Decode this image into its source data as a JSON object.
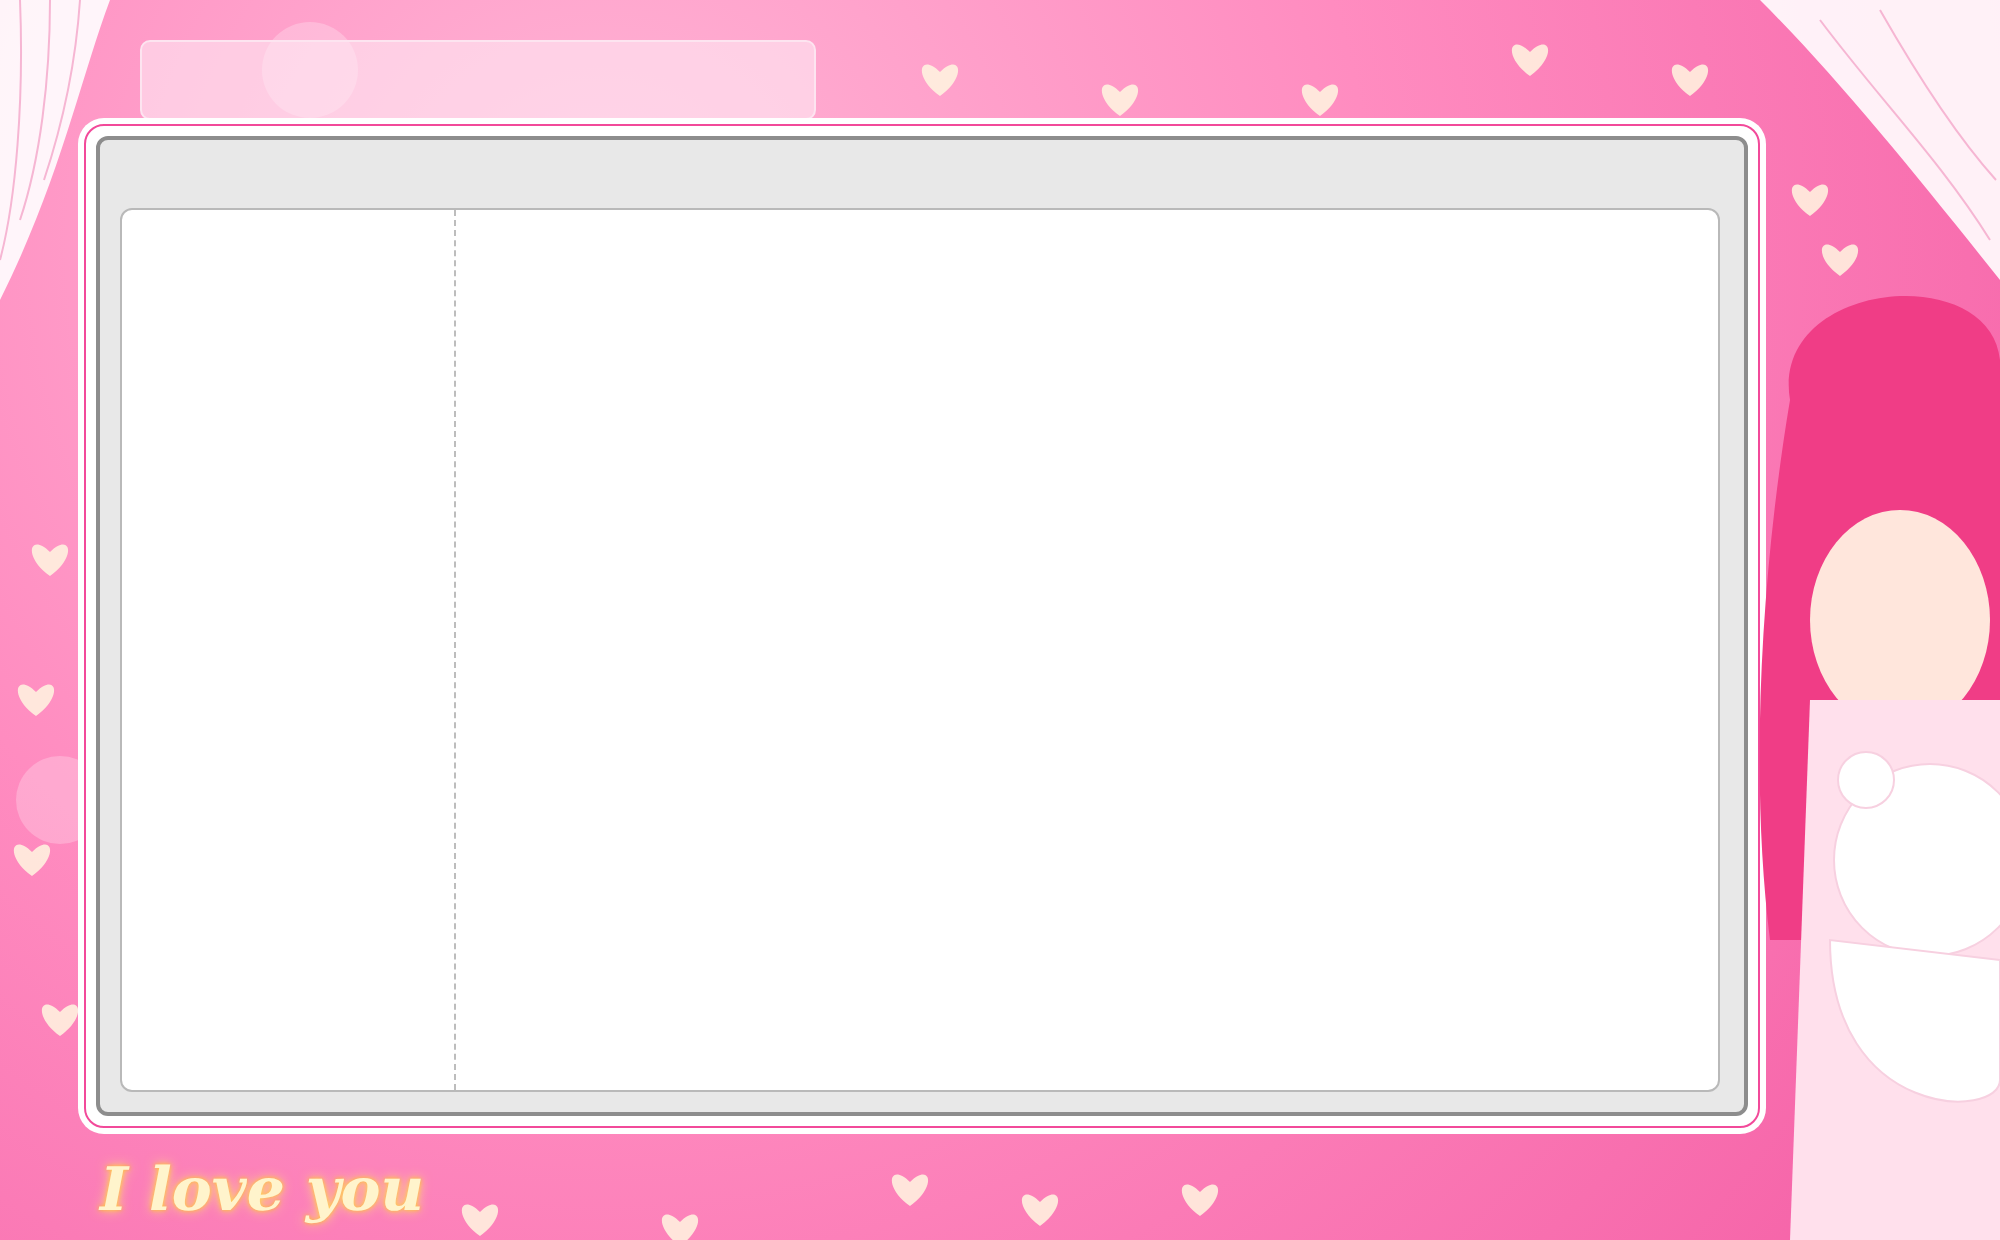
{
  "tagline": "I love you"
}
